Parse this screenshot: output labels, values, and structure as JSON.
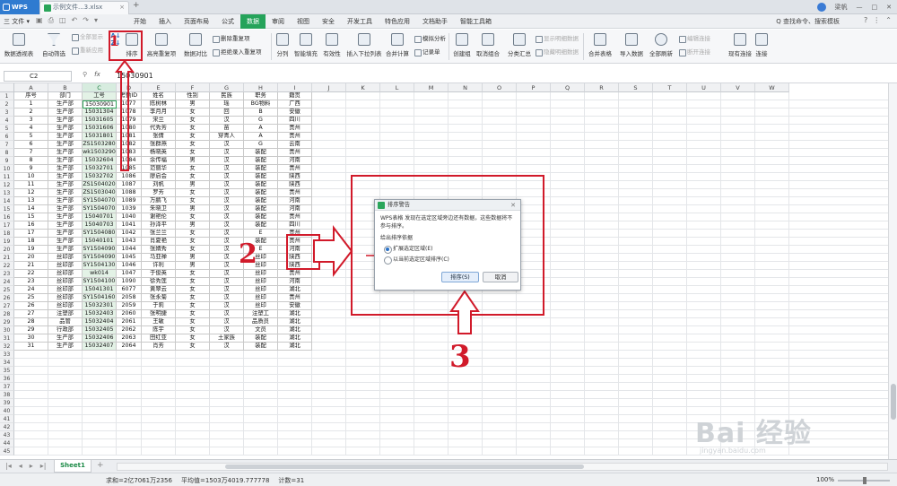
{
  "titlebar": {
    "app": "WPS",
    "doc_tab": "示例文件...3.xlsx",
    "new_tab": "+",
    "user": "梁帆"
  },
  "menubar": {
    "file": "三 文件 ▾",
    "items": [
      "开始",
      "插入",
      "页面布局",
      "公式",
      "数据",
      "审阅",
      "视图",
      "安全",
      "开发工具",
      "特色应用",
      "文档助手",
      "智能工具箱"
    ],
    "active_index": 4,
    "search": "Q 查找命令、搜索模板"
  },
  "ribbon": {
    "buttons": [
      "数据透视表",
      "自动筛选",
      "排序",
      "分列",
      "智能填充",
      "有效性",
      "插入下拉列表",
      "合并计算",
      "创建组",
      "取消组合",
      "分类汇总",
      "合并表格",
      "导入数据",
      "全部刷新",
      "现有连接",
      "连接"
    ],
    "small": [
      "全部显示",
      "重新应用",
      "高亮重复项",
      "删除重复项",
      "拒绝录入重复项",
      "数据对比",
      "模拟分析",
      "记录单",
      "显示明细数据",
      "隐藏明细数据",
      "编辑连接",
      "断开连接"
    ]
  },
  "formulabar": {
    "namebox": "C2",
    "value": "15030901"
  },
  "columns": [
    "A",
    "B",
    "C",
    "D",
    "E",
    "F",
    "G",
    "H",
    "I",
    "J",
    "K",
    "L",
    "M",
    "N",
    "O",
    "P",
    "Q",
    "R",
    "S",
    "T",
    "U",
    "V",
    "W"
  ],
  "table": {
    "headers": [
      "序号",
      "部门",
      "工号",
      "考勤ID",
      "姓名",
      "性别",
      "民族",
      "职务",
      "籍贯"
    ],
    "rows": [
      [
        "1",
        "生产部",
        "15030901",
        "1077",
        "陈树林",
        "男",
        "瑶",
        "BG物料",
        "广西"
      ],
      [
        "2",
        "生产部",
        "15031304",
        "1078",
        "李月月",
        "女",
        "回",
        "B",
        "安徽"
      ],
      [
        "3",
        "生产部",
        "15031605",
        "1079",
        "宋兰",
        "女",
        "汉",
        "G",
        "四川"
      ],
      [
        "4",
        "生产部",
        "15031606",
        "1080",
        "代秀芳",
        "女",
        "苗",
        "A",
        "贵州"
      ],
      [
        "5",
        "生产部",
        "15031801",
        "1081",
        "张倩",
        "女",
        "穿青人",
        "A",
        "贵州"
      ],
      [
        "6",
        "生产部",
        "ZS1503280",
        "1082",
        "张群燕",
        "女",
        "汉",
        "G",
        "云南"
      ],
      [
        "7",
        "生产部",
        "wk1503290",
        "1083",
        "杨晓英",
        "女",
        "汉",
        "装配",
        "贵州"
      ],
      [
        "8",
        "生产部",
        "15032604",
        "1084",
        "余传福",
        "男",
        "汉",
        "装配",
        "河南"
      ],
      [
        "9",
        "生产部",
        "15032701",
        "1085",
        "范丽华",
        "女",
        "汉",
        "装配",
        "贵州"
      ],
      [
        "10",
        "生产部",
        "15032702",
        "1086",
        "廖启会",
        "女",
        "汉",
        "装配",
        "陕西"
      ],
      [
        "11",
        "生产部",
        "ZS1504020",
        "1087",
        "刘帆",
        "男",
        "汉",
        "装配",
        "陕西"
      ],
      [
        "12",
        "生产部",
        "ZS1503040",
        "1088",
        "罗芳",
        "女",
        "汉",
        "装配",
        "贵州"
      ],
      [
        "13",
        "生产部",
        "SY1504070",
        "1089",
        "万鹏飞",
        "女",
        "汉",
        "装配",
        "河南"
      ],
      [
        "14",
        "生产部",
        "SY1504070",
        "1039",
        "朱晓卫",
        "男",
        "汉",
        "装配",
        "河南"
      ],
      [
        "15",
        "生产部",
        "15040701",
        "1040",
        "谢艳伦",
        "女",
        "汉",
        "装配",
        "贵州"
      ],
      [
        "16",
        "生产部",
        "15040703",
        "1041",
        "孙泽平",
        "男",
        "汉",
        "装配",
        "四川"
      ],
      [
        "17",
        "生产部",
        "SY1504080",
        "1042",
        "张兰兰",
        "女",
        "汉",
        "E",
        "贵州"
      ],
      [
        "18",
        "生产部",
        "15040101",
        "1043",
        "肖夏艳",
        "女",
        "汉",
        "装配",
        "贵州"
      ],
      [
        "19",
        "生产部",
        "SY1504090",
        "1044",
        "张婧秀",
        "女",
        "汉",
        "E",
        "河南"
      ],
      [
        "20",
        "丝印部",
        "SY1504090",
        "1045",
        "马亚禅",
        "男",
        "汉",
        "丝印",
        "陕西"
      ],
      [
        "21",
        "丝印部",
        "SY1504130",
        "1046",
        "许利",
        "男",
        "汉",
        "丝印",
        "陕西"
      ],
      [
        "22",
        "丝印部",
        "wk014",
        "1047",
        "于俊英",
        "女",
        "汉",
        "丝印",
        "贵州"
      ],
      [
        "23",
        "丝印部",
        "SY1504100",
        "1090",
        "徐秀莲",
        "女",
        "汉",
        "丝印",
        "河南"
      ],
      [
        "24",
        "丝印部",
        "15041301",
        "6077",
        "黄翠云",
        "女",
        "汉",
        "丝印",
        "湖北"
      ],
      [
        "25",
        "丝印部",
        "SY1504160",
        "2058",
        "张永菊",
        "女",
        "汉",
        "丝印",
        "贵州"
      ],
      [
        "26",
        "丝印部",
        "15032301",
        "2059",
        "于莉",
        "女",
        "汉",
        "丝印",
        "安徽"
      ],
      [
        "27",
        "注塑部",
        "15032403",
        "2060",
        "张明捷",
        "女",
        "汉",
        "注塑工",
        "湖北"
      ],
      [
        "28",
        "品管",
        "15032404",
        "2061",
        "王敏",
        "女",
        "汉",
        "品质员",
        "湖北"
      ],
      [
        "29",
        "行政部",
        "15032405",
        "2062",
        "陈宇",
        "女",
        "汉",
        "文员",
        "湖北"
      ],
      [
        "30",
        "生产部",
        "15032406",
        "2063",
        "田红亚",
        "女",
        "土家族",
        "装配",
        "湖北"
      ],
      [
        "31",
        "生产部",
        "15032407",
        "2064",
        "肖芳",
        "女",
        "汉",
        "装配",
        "湖北"
      ]
    ]
  },
  "sheetbar": {
    "tab": "Sheet1",
    "add": "+"
  },
  "status": {
    "sum": "求和=2亿7061万2356",
    "avg": "平均值=1503万4019.777778",
    "count": "计数=31",
    "zoom": "100%"
  },
  "dialog": {
    "title": "排序警告",
    "message": "WPS表格 发现在选定区域旁边还有数据，这些数据将不参与排序。",
    "group": "给出排序依据",
    "option1": "扩展选定区域(E)",
    "option2": "以当前选定区域排序(C)",
    "sort": "排序(S)",
    "cancel": "取消",
    "close": "✕"
  },
  "annotations": {
    "n1": "1",
    "n2": "2",
    "n3": "3",
    "color": "#d11a2a"
  },
  "watermark": {
    "text": "Bai 经验",
    "sub": "jingyan.baidu.com"
  }
}
